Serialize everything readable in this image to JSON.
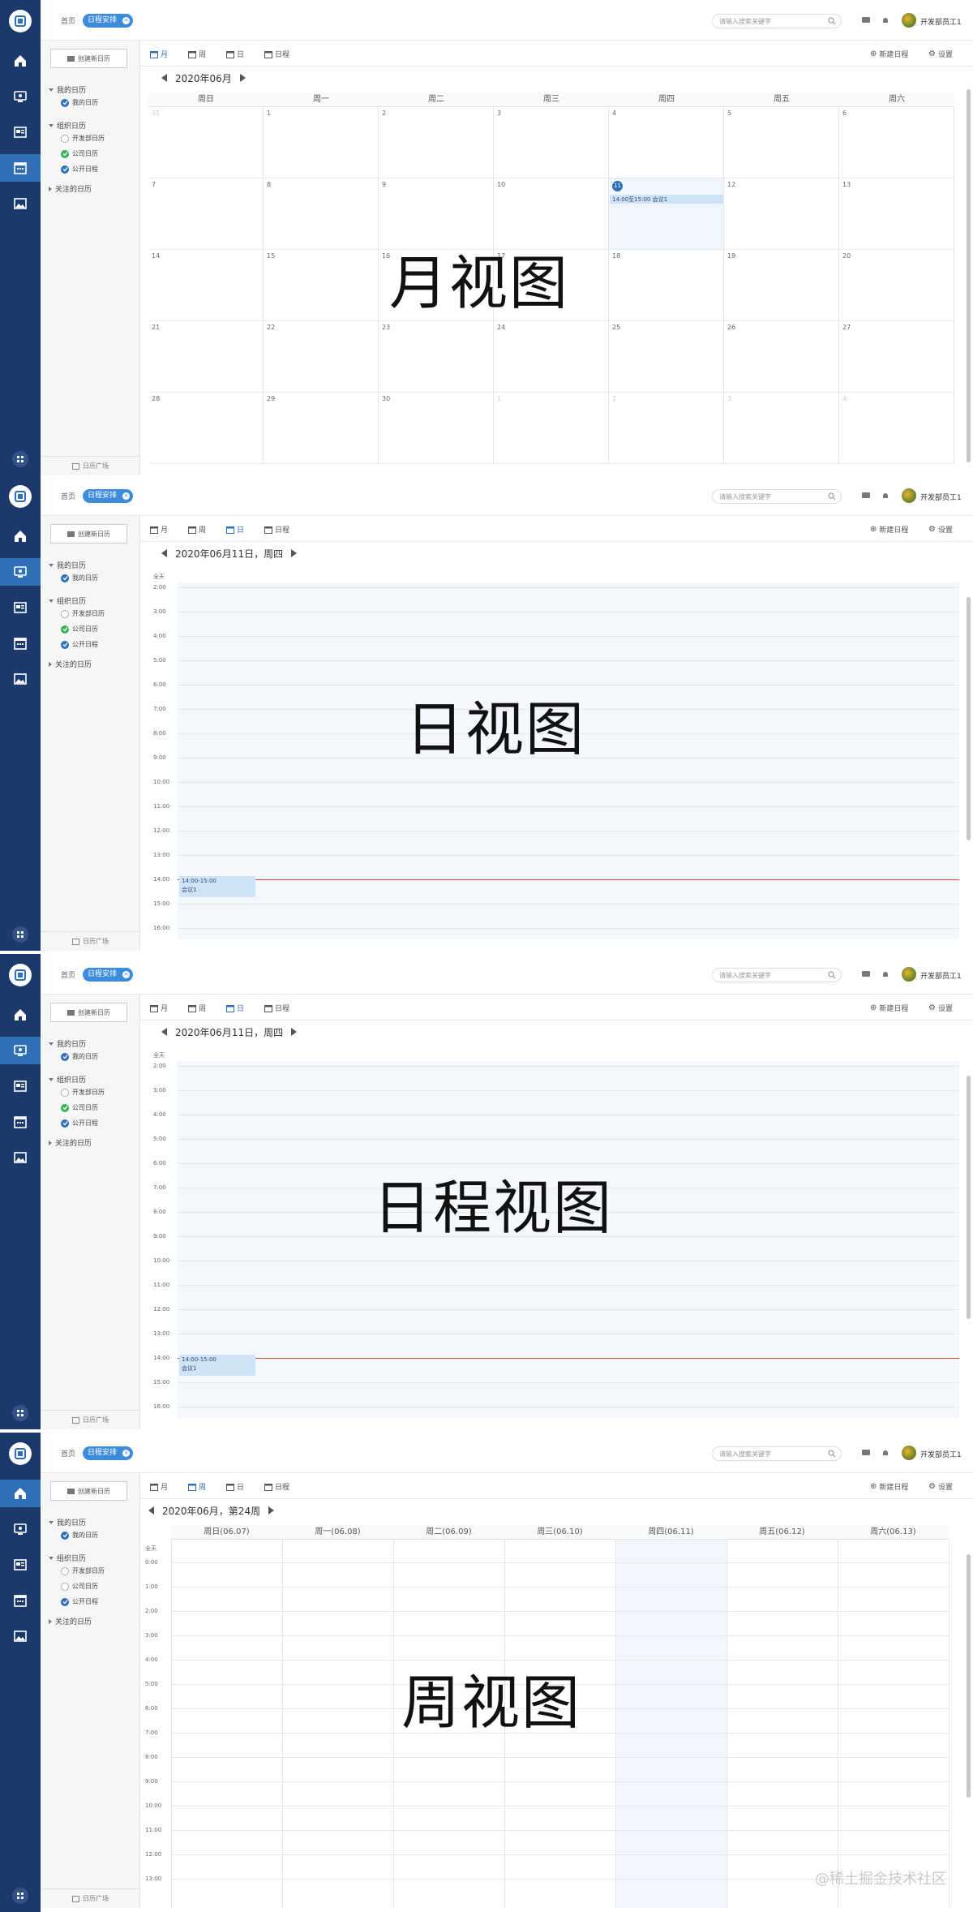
{
  "topbar": {
    "home": "首页",
    "active_tab": "日程安排",
    "search_placeholder": "请输入搜索关键字",
    "user": "开发部员工1"
  },
  "left": {
    "create": "创建新日历",
    "my_group": "我的日历",
    "my_cal": "我的日历",
    "org_group": "组织日历",
    "dev_cal": "开发部日历",
    "company_cal": "公司日历",
    "public_sched": "公开日程",
    "follow_group": "关注的日历",
    "footer": "日历广场"
  },
  "views": {
    "month": "月",
    "week": "周",
    "day": "日",
    "agenda": "日程",
    "new": "新建日程",
    "settings": "设置"
  },
  "panels": {
    "month_title": "2020年06月",
    "day_title": "2020年06月11日，周四",
    "week_title": "2020年06月，第24周",
    "allday": "全天",
    "labels": [
      "月视图",
      "日视图",
      "日程视图",
      "周视图"
    ]
  },
  "month": {
    "weekdays": [
      "周日",
      "周一",
      "周二",
      "周三",
      "周四",
      "周五",
      "周六"
    ],
    "days": [
      [
        "31",
        "1",
        "2",
        "3",
        "4",
        "5",
        "6"
      ],
      [
        "7",
        "8",
        "9",
        "10",
        "11",
        "12",
        "13"
      ],
      [
        "14",
        "15",
        "16",
        "17",
        "18",
        "19",
        "20"
      ],
      [
        "21",
        "22",
        "23",
        "24",
        "25",
        "26",
        "27"
      ],
      [
        "28",
        "29",
        "30",
        "1",
        "2",
        "3",
        "4"
      ]
    ],
    "event": "14:00至15:00 会议1"
  },
  "day": {
    "hours": [
      "2:00",
      "3:00",
      "4:00",
      "5:00",
      "6:00",
      "7:00",
      "8:00",
      "9:00",
      "10:00",
      "11:00",
      "12:00",
      "13:00",
      "14:00",
      "15:00",
      "16:00"
    ],
    "event_time": "14:00-15:00",
    "event_title": "会议1"
  },
  "week": {
    "headers": [
      "周日(06.07)",
      "周一(06.08)",
      "周二(06.09)",
      "周三(06.10)",
      "周四(06.11)",
      "周五(06.12)",
      "周六(06.13)"
    ],
    "hours": [
      "0:00",
      "1:00",
      "2:00",
      "3:00",
      "4:00",
      "5:00",
      "6:00",
      "7:00",
      "8:00",
      "9:00",
      "10:00",
      "11:00",
      "12:00",
      "13:00"
    ]
  },
  "credit": "@稀土掘金技术社区",
  "colors": {
    "sidebar": "#1b3a6b",
    "accent": "#2f6fb5",
    "event": "#cfe3f7",
    "now_line": "#d84a3a"
  }
}
